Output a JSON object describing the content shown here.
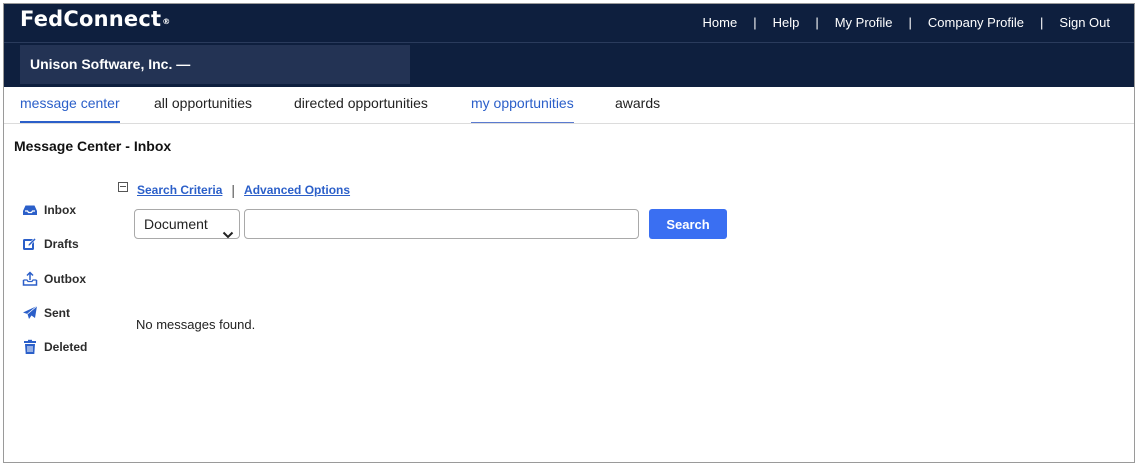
{
  "app": {
    "brand": "FedConnect",
    "brand_mark": "®"
  },
  "topnav": {
    "items": [
      {
        "label": "Home"
      },
      {
        "label": "Help"
      },
      {
        "label": "My Profile"
      },
      {
        "label": "Company Profile"
      },
      {
        "label": "Sign Out"
      }
    ],
    "separator": "|"
  },
  "company": {
    "name": "Unison Software, Inc. —"
  },
  "tabs": [
    {
      "label": "message center",
      "state": "active"
    },
    {
      "label": "all opportunities",
      "state": "normal"
    },
    {
      "label": "directed opportunities",
      "state": "normal"
    },
    {
      "label": "my opportunities",
      "state": "underlined"
    },
    {
      "label": "awards",
      "state": "normal"
    }
  ],
  "page": {
    "title": "Message Center - Inbox"
  },
  "sidebar": {
    "items": [
      {
        "label": "Inbox",
        "icon": "inbox-icon"
      },
      {
        "label": "Drafts",
        "icon": "edit-icon"
      },
      {
        "label": "Outbox",
        "icon": "outbox-tray-icon"
      },
      {
        "label": "Sent",
        "icon": "paper-plane-icon"
      },
      {
        "label": "Deleted",
        "icon": "trash-icon"
      }
    ]
  },
  "search": {
    "criteria_label": "Search Criteria",
    "separator": "|",
    "advanced_label": "Advanced Options",
    "type_selected": "Document",
    "query_value": "",
    "button_label": "Search"
  },
  "messages": {
    "empty_text": "No messages found."
  },
  "colors": {
    "header_bg": "#0e1f3e",
    "company_bg": "#233354",
    "accent": "#2b5fc9",
    "button": "#3a6ff2"
  }
}
